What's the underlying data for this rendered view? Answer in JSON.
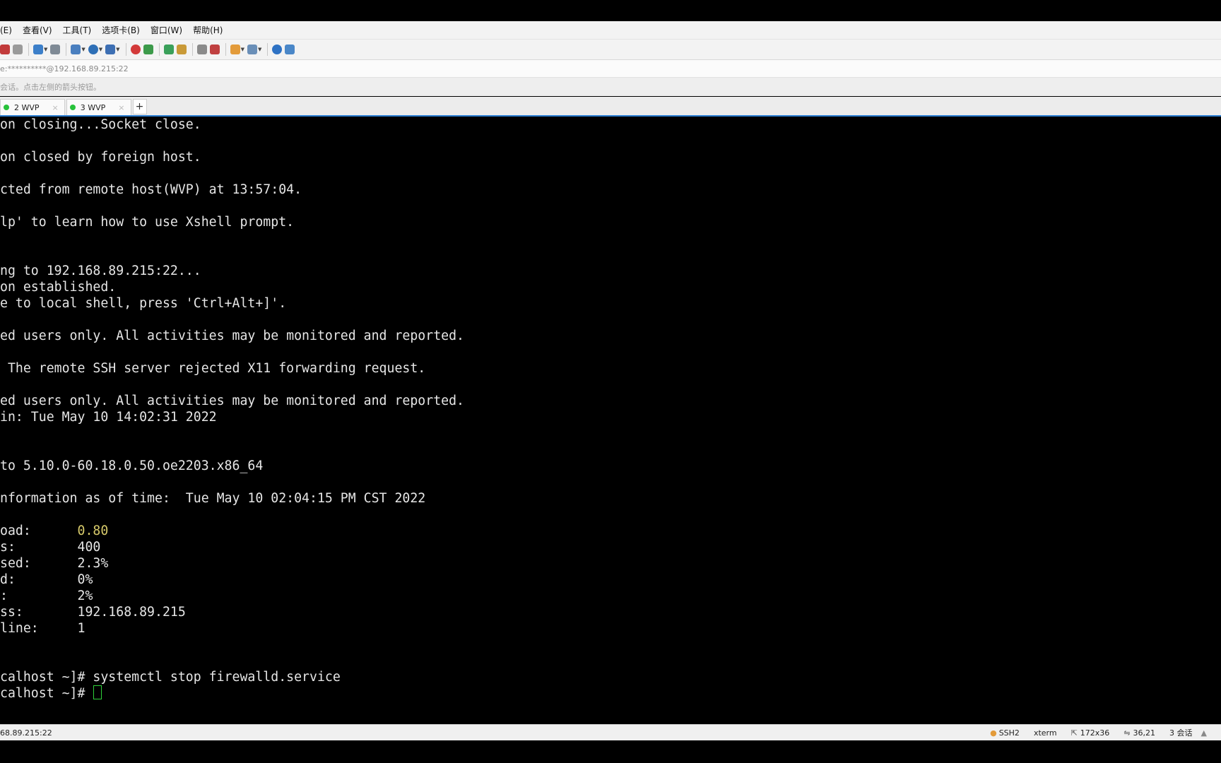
{
  "menubar": {
    "items": [
      "(E)",
      "查看(V)",
      "工具(T)",
      "选项卡(B)",
      "窗口(W)",
      "帮助(H)"
    ]
  },
  "toolbar": {
    "icons": [
      {
        "name": "properties-icon",
        "color": "#c23b3b"
      },
      {
        "name": "disconnect-icon",
        "color": "#9a9a9a"
      },
      {
        "name": "new-session-icon",
        "color": "#3c7fc9"
      },
      {
        "name": "find-icon",
        "color": "#7f8a95"
      },
      {
        "name": "layout-icon",
        "color": "#4a7fbf"
      },
      {
        "name": "globe-icon",
        "color": "#2e6fb6"
      },
      {
        "name": "font-icon",
        "color": "#3d6fb3"
      },
      {
        "name": "xshell-icon",
        "color": "#d33a3a"
      },
      {
        "name": "xftp-icon",
        "color": "#3c9a4a"
      },
      {
        "name": "fullscreen-icon",
        "color": "#3aa05a"
      },
      {
        "name": "lock-icon",
        "color": "#c99a38"
      },
      {
        "name": "keyboard-icon",
        "color": "#8a8a8a"
      },
      {
        "name": "highlight-icon",
        "color": "#c04040"
      },
      {
        "name": "folder-icon",
        "color": "#e39b3a"
      },
      {
        "name": "window-layout-icon",
        "color": "#6a8fb8"
      },
      {
        "name": "help-icon",
        "color": "#2e72c4"
      },
      {
        "name": "chat-icon",
        "color": "#4a87c8"
      }
    ]
  },
  "address": {
    "text": "e:**********@192.168.89.215:22"
  },
  "hint": {
    "text": "会话。点击左侧的箭头按钮。"
  },
  "tabs": [
    {
      "label": "2 WVP",
      "status_color": "#27c23a"
    },
    {
      "label": "3 WVP",
      "status_color": "#27c23a"
    }
  ],
  "tab_add_label": "+",
  "terminal": {
    "lines": [
      {
        "text": "on closing...Socket close."
      },
      {
        "text": ""
      },
      {
        "text": "on closed by foreign host."
      },
      {
        "text": ""
      },
      {
        "text": "cted from remote host(WVP) at 13:57:04."
      },
      {
        "text": ""
      },
      {
        "text": "lp' to learn how to use Xshell prompt."
      },
      {
        "text": ""
      },
      {
        "text": ""
      },
      {
        "text": "ng to 192.168.89.215:22..."
      },
      {
        "text": "on established."
      },
      {
        "text": "e to local shell, press 'Ctrl+Alt+]'."
      },
      {
        "text": ""
      },
      {
        "text": "ed users only. All activities may be monitored and reported."
      },
      {
        "text": ""
      },
      {
        "text": " The remote SSH server rejected X11 forwarding request."
      },
      {
        "text": ""
      },
      {
        "text": "ed users only. All activities may be monitored and reported."
      },
      {
        "text": "in: Tue May 10 14:02:31 2022"
      },
      {
        "text": ""
      },
      {
        "text": ""
      },
      {
        "text": "to 5.10.0-60.18.0.50.oe2203.x86_64"
      },
      {
        "text": ""
      },
      {
        "text": "nformation as of time:  Tue May 10 02:04:15 PM CST 2022"
      },
      {
        "text": ""
      },
      {
        "label": "oad:      ",
        "value": "0.80",
        "highlight": true
      },
      {
        "label": "s:        ",
        "value": "400"
      },
      {
        "label": "sed:      ",
        "value": "2.3%"
      },
      {
        "label": "d:        ",
        "value": "0%"
      },
      {
        "label": ":         ",
        "value": "2%"
      },
      {
        "label": "ss:       ",
        "value": "192.168.89.215"
      },
      {
        "label": "line:     ",
        "value": "1"
      },
      {
        "text": ""
      },
      {
        "text": ""
      },
      {
        "text": "calhost ~]# systemctl stop firewalld.service"
      },
      {
        "text": "calhost ~]# ",
        "cursor": true
      }
    ]
  },
  "statusbar": {
    "left": "68.89.215:22",
    "protocol": "SSH2",
    "terminal_type": "xterm",
    "size": "172x36",
    "position": "36,21",
    "sessions": "3 会话"
  }
}
